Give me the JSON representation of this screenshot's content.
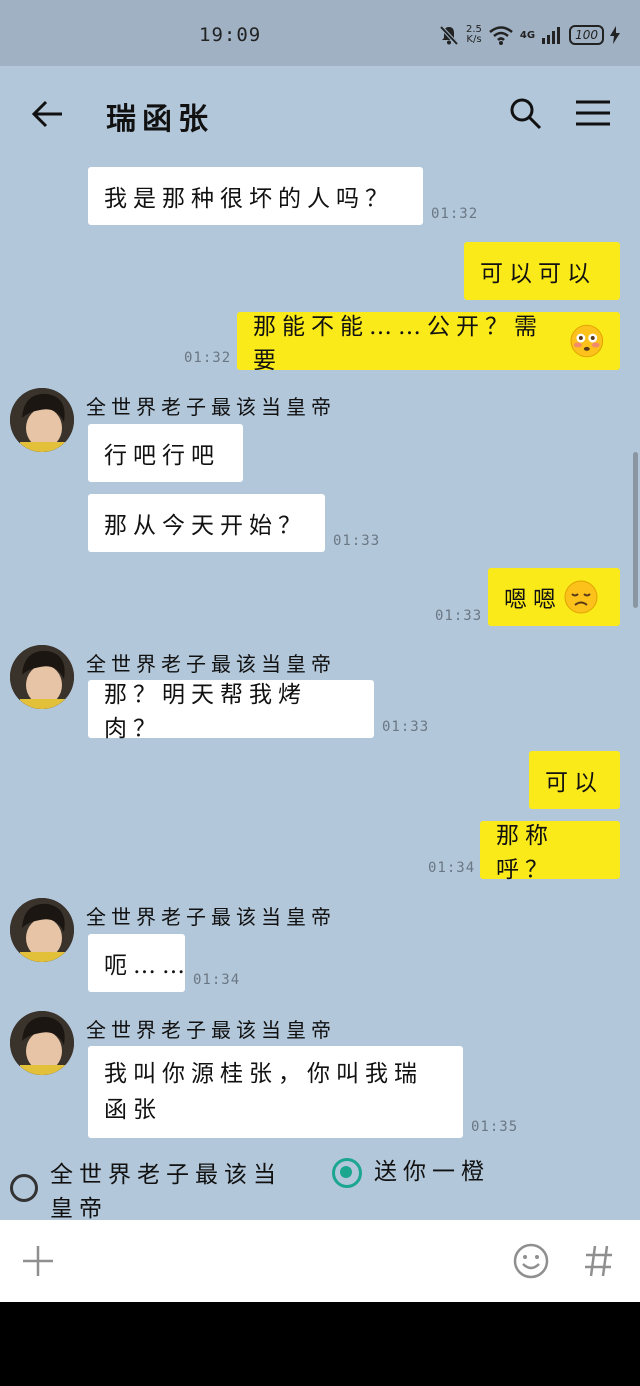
{
  "status_bar": {
    "time": "19:09",
    "net_speed_value": "2.5",
    "net_speed_unit": "K/s",
    "network": "4G",
    "battery": "100"
  },
  "header": {
    "title": "瑞函张"
  },
  "colors": {
    "background": "#b3c7da",
    "incoming_bubble": "#ffffff",
    "outgoing_bubble": "#fbea1a",
    "radio_selected": "#1aa68f"
  },
  "messages": [
    {
      "direction": "in",
      "text": "我是那种很坏的人吗？",
      "time": "01:32"
    },
    {
      "direction": "out",
      "text": "可以可以"
    },
    {
      "direction": "out",
      "text": "那能不能……公开？需要",
      "emoji": "flushed-face",
      "time": "01:32"
    },
    {
      "direction": "in",
      "sender": "全世界老子最该当皇帝",
      "text": "行吧行吧"
    },
    {
      "direction": "in",
      "text": "那从今天开始？",
      "time": "01:33"
    },
    {
      "direction": "out",
      "text": "嗯嗯",
      "emoji": "disappointed-face",
      "time": "01:33"
    },
    {
      "direction": "in",
      "sender": "全世界老子最该当皇帝",
      "text": "那？明天帮我烤肉？",
      "time": "01:33"
    },
    {
      "direction": "out",
      "text": "可以"
    },
    {
      "direction": "out",
      "text": "那称呼？",
      "time": "01:34"
    },
    {
      "direction": "in",
      "sender": "全世界老子最该当皇帝",
      "text": "呃……",
      "time": "01:34"
    },
    {
      "direction": "in",
      "sender": "全世界老子最该当皇帝",
      "text_line1": "我叫你源桂张，你叫我瑞",
      "text_line2": "函张",
      "time": "01:35"
    }
  ],
  "poll": {
    "options": [
      {
        "label_line1": "全世界老子最该当",
        "label_line2": "皇帝",
        "selected": false
      },
      {
        "label_line1": "送你一橙",
        "selected": true
      }
    ]
  },
  "input_bar": {
    "icons": [
      "plus-icon",
      "emoji-icon",
      "hashtag-icon"
    ]
  }
}
